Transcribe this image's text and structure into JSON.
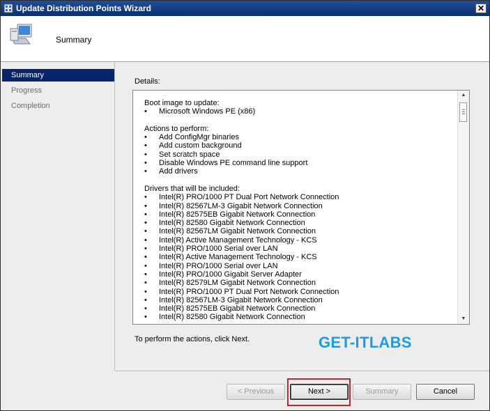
{
  "window": {
    "title": "Update Distribution Points Wizard",
    "close_glyph": "✕"
  },
  "header": {
    "title": "Summary",
    "icon": "computer-icon"
  },
  "nav": {
    "items": [
      {
        "label": "Summary",
        "active": true
      },
      {
        "label": "Progress",
        "active": false
      },
      {
        "label": "Completion",
        "active": false
      }
    ]
  },
  "details": {
    "label": "Details:",
    "boot_image_heading": "Boot image to update:",
    "boot_image_items": [
      "Microsoft Windows PE (x86)"
    ],
    "actions_heading": "Actions to perform:",
    "actions_items": [
      "Add ConfigMgr binaries",
      "Add custom background",
      "Set scratch space",
      "Disable Windows PE command line support",
      "Add drivers"
    ],
    "drivers_heading": "Drivers that will be included:",
    "drivers_items": [
      "Intel(R) PRO/1000 PT Dual Port Network Connection",
      "Intel(R) 82567LM-3 Gigabit Network Connection",
      "Intel(R) 82575EB Gigabit Network Connection",
      "Intel(R) 82580 Gigabit Network Connection",
      "Intel(R) 82567LM Gigabit Network Connection",
      "Intel(R) Active Management Technology - KCS",
      "Intel(R) PRO/1000 Serial over LAN",
      "Intel(R) Active Management Technology - KCS",
      "Intel(R) PRO/1000 Serial over LAN",
      "Intel(R) PRO/1000 Gigabit Server Adapter",
      "Intel(R) 82579LM Gigabit Network Connection",
      "Intel(R) PRO/1000 PT Dual Port Network Connection",
      "Intel(R) 82567LM-3 Gigabit Network Connection",
      "Intel(R) 82575EB Gigabit Network Connection",
      "Intel(R) 82580 Gigabit Network Connection"
    ],
    "bullet": "•"
  },
  "instruction": "To perform the actions, click Next.",
  "watermark": "GET-ITLABS",
  "buttons": {
    "previous": "< Previous",
    "next": "Next >",
    "summary": "Summary",
    "cancel": "Cancel"
  },
  "colors": {
    "highlight": "#c0262c",
    "watermark": "#1e9be6",
    "nav_active": "#0a246a"
  }
}
